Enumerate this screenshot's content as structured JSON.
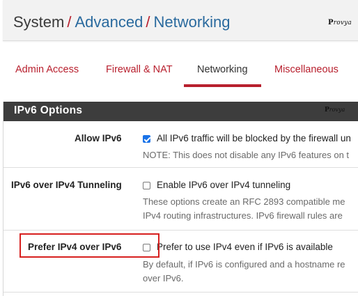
{
  "breadcrumb": {
    "root": "System",
    "sep1": "/",
    "item1": "Advanced",
    "sep2": "/",
    "item2": "Networking"
  },
  "logo": "Provya",
  "tabs": [
    {
      "label": "Admin Access",
      "active": false
    },
    {
      "label": "Firewall & NAT",
      "active": false
    },
    {
      "label": "Networking",
      "active": true
    },
    {
      "label": "Miscellaneous",
      "active": false
    }
  ],
  "panel": {
    "title": "IPv6 Options",
    "logo": "Provya"
  },
  "rows": [
    {
      "label": "Allow IPv6",
      "checkbox_checked": true,
      "checkbox_label": "All IPv6 traffic will be blocked by the firewall un",
      "help": [
        "NOTE: This does not disable any IPv6 features on t"
      ]
    },
    {
      "label": "IPv6 over IPv4 Tunneling",
      "checkbox_checked": false,
      "checkbox_label": "Enable IPv6 over IPv4 tunneling",
      "help": [
        "These options create an RFC 2893 compatible me",
        "IPv4 routing infrastructures. IPv6 firewall rules are"
      ]
    },
    {
      "label": "Prefer IPv4 over IPv6",
      "checkbox_checked": false,
      "checkbox_label": "Prefer to use IPv4 even if IPv6 is available",
      "help": [
        "By default, if IPv6 is configured and a hostname re",
        "over IPv6."
      ]
    }
  ],
  "colors": {
    "accent": "#b8202e",
    "link": "#2a6a9e",
    "panel_header": "#3d3d3d",
    "checkbox_checked": "#1a73e8",
    "highlight": "#d7201f"
  }
}
